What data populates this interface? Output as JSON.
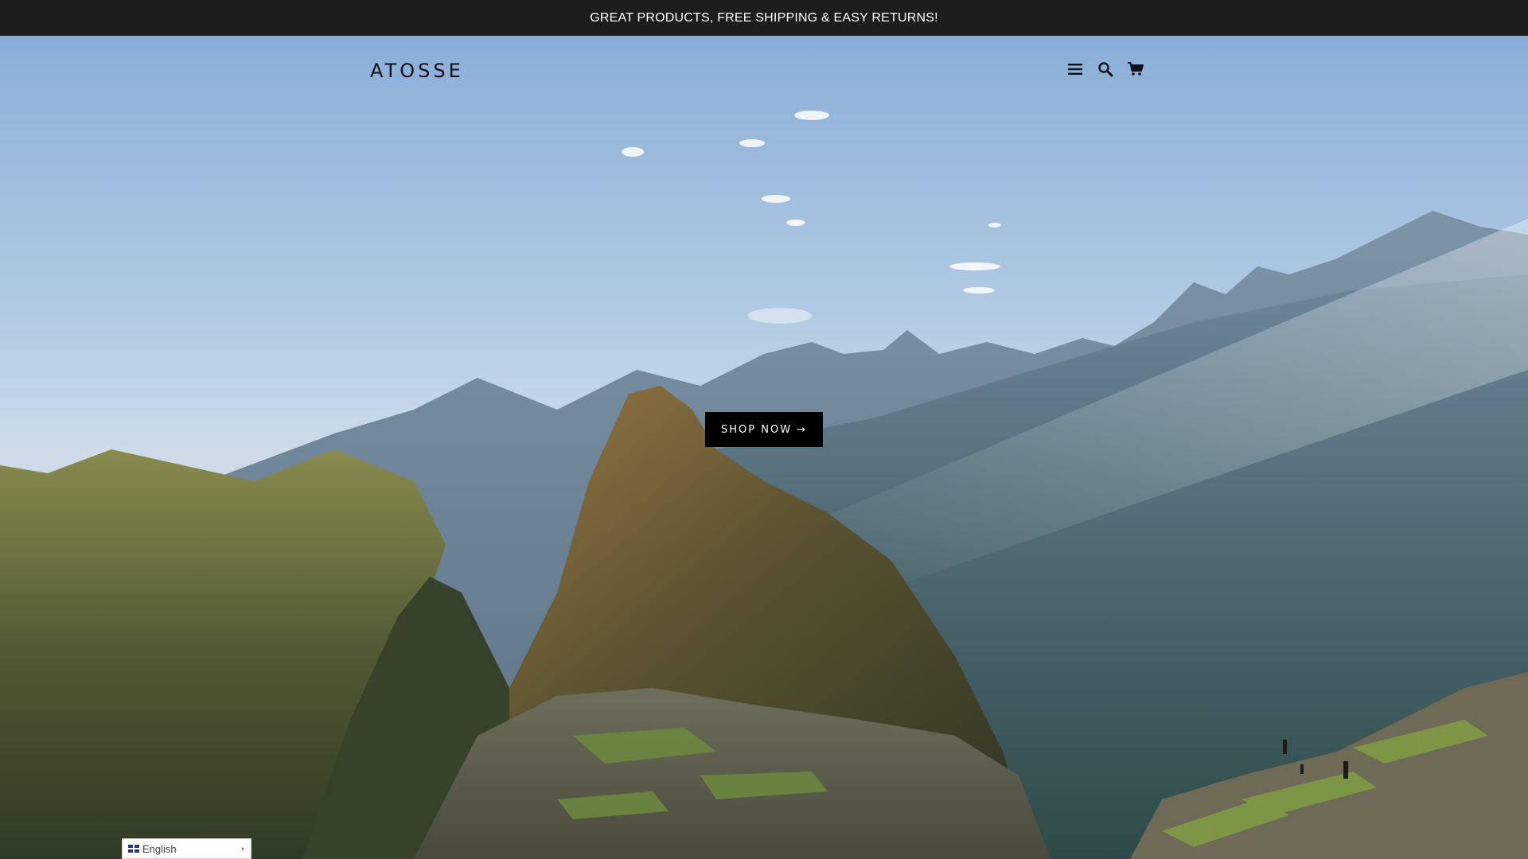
{
  "announcement": {
    "text": "GREAT PRODUCTS, FREE SHIPPING & EASY RETURNS!"
  },
  "header": {
    "logo": "ATOSSE",
    "icons": [
      "hamburger-menu-icon",
      "search-icon",
      "cart-icon"
    ]
  },
  "hero": {
    "cta_label": "SHOP NOW",
    "cta_arrow": "→",
    "image_subject": "mountain landscape"
  },
  "language": {
    "selected": "English",
    "caret": "▾"
  },
  "colors": {
    "announcement_bg": "#1c1d1d",
    "announcement_text": "#ffffff",
    "cta_bg": "#000000",
    "cta_text": "#ffffff",
    "logo_text": "#111111"
  }
}
